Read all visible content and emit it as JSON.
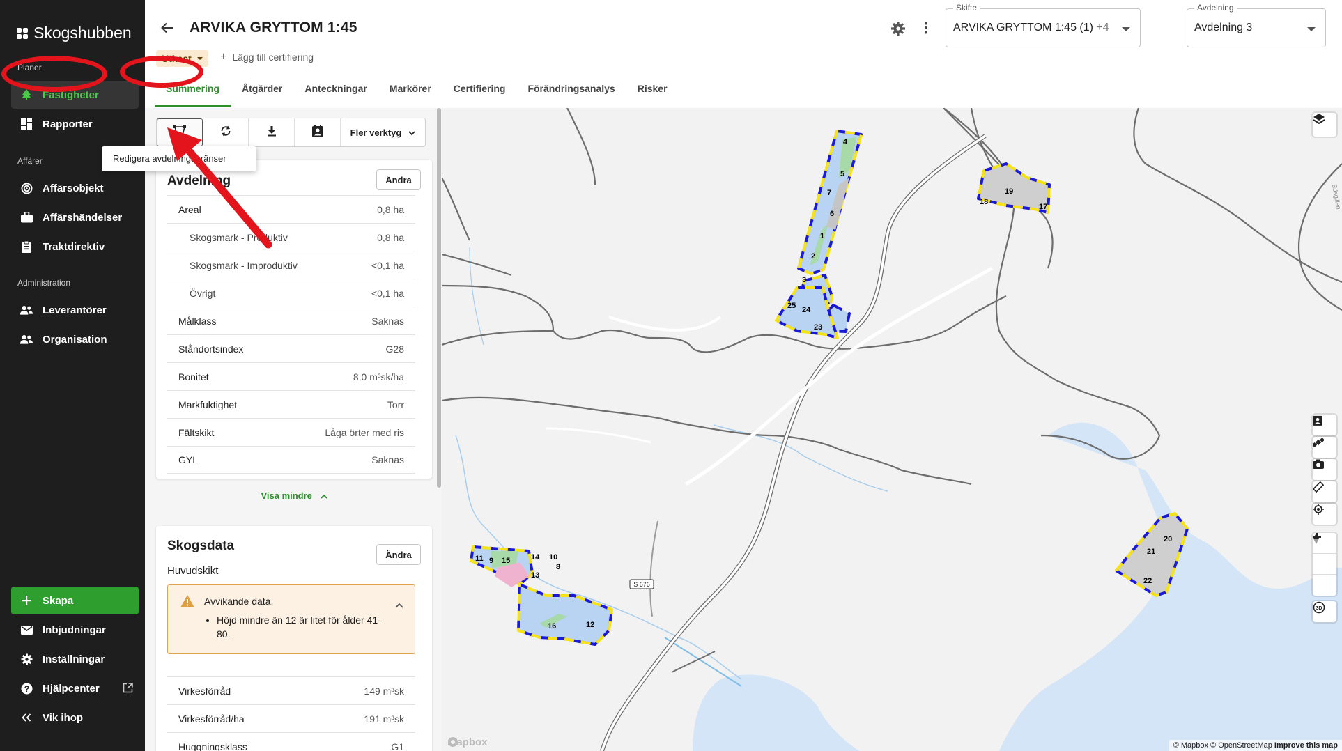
{
  "brand": "Skogshubben",
  "sidebar": {
    "sections": [
      {
        "label": "Planer"
      },
      {
        "label": "Affärer"
      },
      {
        "label": "Administration"
      }
    ],
    "items": [
      {
        "label": "Fastigheter",
        "icon": "tree-icon",
        "active": true
      },
      {
        "label": "Rapporter",
        "icon": "dashboard-icon"
      },
      {
        "label": "Affärsobjekt",
        "icon": "target-icon"
      },
      {
        "label": "Affärshändelser",
        "icon": "briefcase-icon"
      },
      {
        "label": "Traktdirektiv",
        "icon": "clipboard-icon"
      },
      {
        "label": "Leverantörer",
        "icon": "people-icon"
      },
      {
        "label": "Organisation",
        "icon": "people-icon"
      }
    ],
    "bottom": {
      "create": "Skapa",
      "invites": "Inbjudningar",
      "settings": "Inställningar",
      "help": "Hjälpcenter",
      "collapse": "Vik ihop"
    }
  },
  "header": {
    "title": "ARVIKA GRYTTOM 1:45",
    "status_badge": "Utkast",
    "add_cert": "Lägg till certifiering",
    "tabs": [
      "Summering",
      "Åtgärder",
      "Anteckningar",
      "Markörer",
      "Certifiering",
      "Förändringsanalys",
      "Risker"
    ],
    "active_tab": "Summering",
    "skifte": {
      "legend": "Skifte",
      "value": "ARVIKA GRYTTOM 1:45 (1)",
      "extra": "+4"
    },
    "avdelning": {
      "legend": "Avdelning",
      "value": "Avdelning 3"
    }
  },
  "toolbar": {
    "more": "Fler verktyg",
    "tooltip": "Redigera avdelningsgränser"
  },
  "avdelning_card": {
    "title": "Avdelning",
    "edit": "Ändra",
    "rows": [
      {
        "k": "Areal",
        "v": "0,8 ha"
      },
      {
        "k": "Skogsmark - Produktiv",
        "v": "0,8 ha",
        "sub": true
      },
      {
        "k": "Skogsmark - Improduktiv",
        "v": "<0,1 ha",
        "sub": true
      },
      {
        "k": "Övrigt",
        "v": "<0,1 ha",
        "sub": true
      },
      {
        "k": "Målklass",
        "v": "Saknas"
      },
      {
        "k": "Ståndortsindex",
        "v": "G28"
      },
      {
        "k": "Bonitet",
        "v": "8,0 m³sk/ha"
      },
      {
        "k": "Markfuktighet",
        "v": "Torr"
      },
      {
        "k": "Fältskikt",
        "v": "Låga örter med ris"
      },
      {
        "k": "GYL",
        "v": "Saknas"
      }
    ],
    "less": "Visa mindre"
  },
  "skogsdata_card": {
    "title": "Skogsdata",
    "edit": "Ändra",
    "subtitle": "Huvudskikt",
    "warning_title": "Avvikande data.",
    "warning_item": "Höjd mindre än 12 är litet för ålder 41-80.",
    "rows": [
      {
        "k": "Virkesförråd",
        "v": "149 m³sk"
      },
      {
        "k": "Virkesförråd/ha",
        "v": "191 m³sk"
      },
      {
        "k": "Huggningsklass",
        "v": "G1"
      }
    ]
  },
  "map": {
    "road_label": "S 676",
    "side_label": "Edsgillen",
    "attribution": "© Mapbox © OpenStreetMap",
    "improve": "Improve this map",
    "logo": "mapbox",
    "parcel_labels": [
      "1",
      "2",
      "3",
      "4",
      "5",
      "6",
      "7",
      "8",
      "9",
      "10",
      "11",
      "12",
      "13",
      "14",
      "15",
      "16",
      "17",
      "18",
      "19",
      "20",
      "21",
      "22",
      "23",
      "24",
      "25"
    ]
  },
  "colors": {
    "sidebar_bg": "#1e1e1e",
    "accent_green": "#2c8f2c",
    "annotation_red": "#e3141b",
    "parcel_border_blue": "#1a1ad6",
    "parcel_border_yellow": "#f5e21a",
    "water": "#d3e5f7"
  }
}
